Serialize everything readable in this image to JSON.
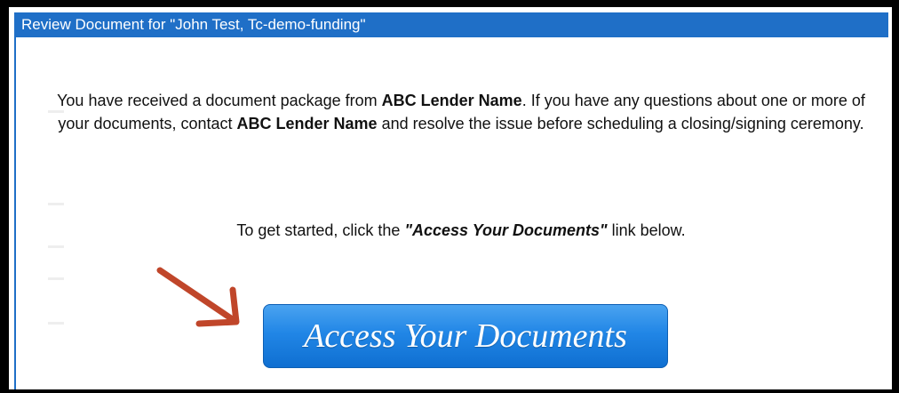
{
  "window": {
    "title": "Review Document for \"John Test, Tc-demo-funding\""
  },
  "intro": {
    "part1": "You have received a document package from ",
    "lender1": "ABC Lender Name",
    "part2": ". If you have any questions about one or more of your documents, contact ",
    "lender2": "ABC Lender Name",
    "part3": " and resolve the issue before scheduling a closing/signing ceremony."
  },
  "instruction": {
    "prefix": "To get started, click the ",
    "link_name": "\"Access Your Documents\"",
    "suffix": " link below."
  },
  "access_button": {
    "label": "Access Your Documents"
  },
  "colors": {
    "titlebar": "#1f6fc7",
    "button": "#2186e6",
    "arrow": "#c0462a"
  },
  "icons": {
    "pointer": "arrow-icon"
  }
}
